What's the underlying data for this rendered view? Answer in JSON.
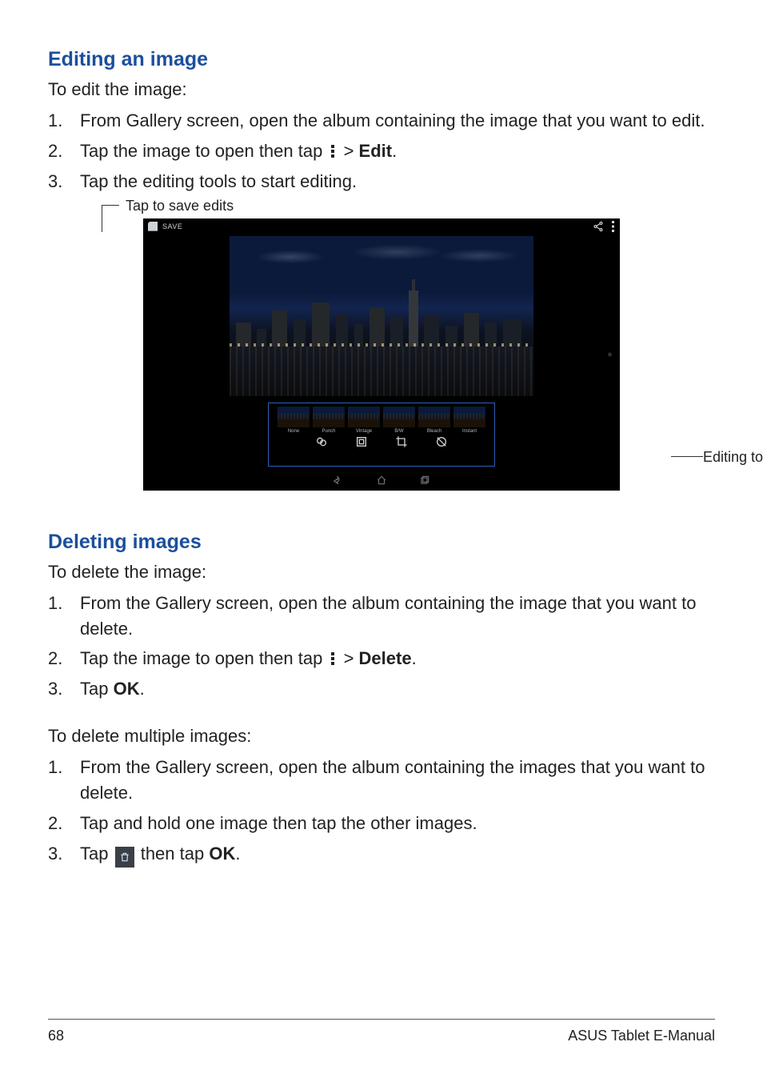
{
  "section1": {
    "title": "Editing an image",
    "intro": "To edit the image:",
    "steps": [
      {
        "num": "1.",
        "text": "From Gallery screen, open the album containing the image that you want to edit."
      },
      {
        "num": "2.",
        "pre": "Tap the image to open then tap ",
        "post": " > ",
        "bold": "Edit",
        "tail": "."
      },
      {
        "num": "3.",
        "text": "Tap the editing tools to start editing."
      }
    ]
  },
  "figure": {
    "callout_save": "Tap to save edits",
    "callout_tools": "Editing tools",
    "topbar_save": "SAVE",
    "filters": [
      "None",
      "Punch",
      "Vintage",
      "B/W",
      "Bleach",
      "Instant"
    ]
  },
  "section2": {
    "title": "Deleting images",
    "intro": "To delete the image:",
    "steps": [
      {
        "num": "1.",
        "text": "From the Gallery screen, open the album containing the image that you want to delete."
      },
      {
        "num": "2.",
        "pre": "Tap the image to open then tap ",
        "post": " > ",
        "bold": "Delete",
        "tail": "."
      },
      {
        "num": "3.",
        "pre": "Tap ",
        "bold": "OK",
        "tail": "."
      }
    ],
    "intro2": "To delete multiple images:",
    "steps2": [
      {
        "num": "1.",
        "text": "From the Gallery screen, open the album containing the images that you want to delete."
      },
      {
        "num": "2.",
        "text": "Tap and hold one image then tap the other images."
      },
      {
        "num": "3.",
        "pre": "Tap ",
        "mid": " then tap ",
        "bold": "OK",
        "tail": "."
      }
    ]
  },
  "footer": {
    "page": "68",
    "label": "ASUS Tablet E-Manual"
  }
}
